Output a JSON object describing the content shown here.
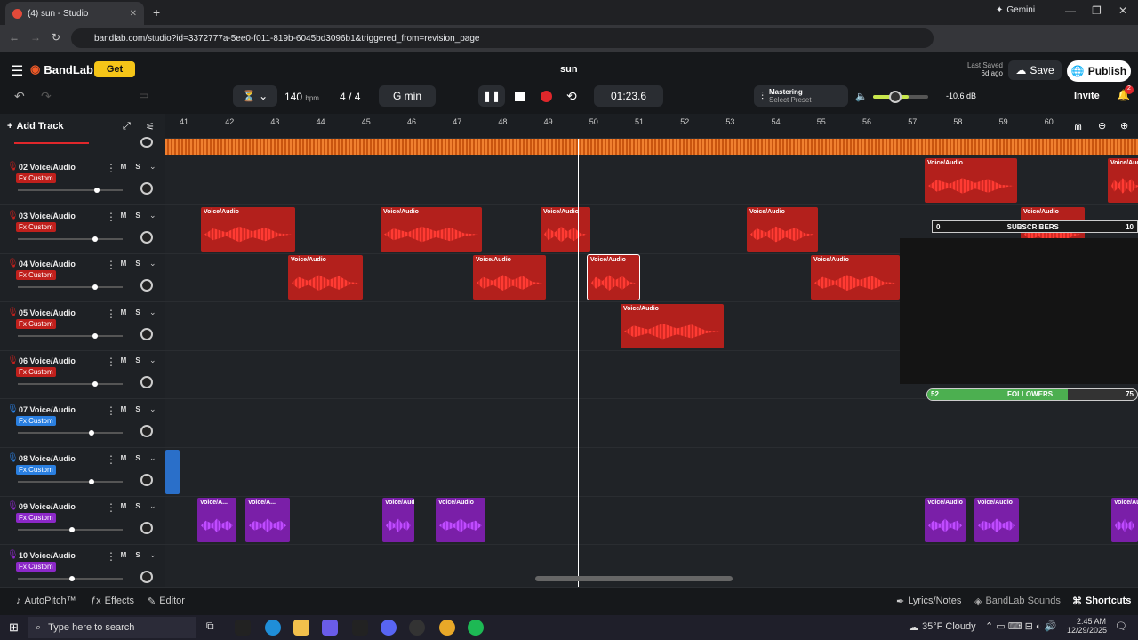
{
  "browser": {
    "tab_title": "(4) sun - Studio",
    "url": "bandlab.com/studio?id=3372777a-5ee0-f011-819b-6045bd3096b1&triggered_from=revision_page",
    "gemini_label": "Gemini"
  },
  "header": {
    "logo_text": "BandLab",
    "get_label": "Get",
    "project_title": "sun",
    "last_saved_label": "Last Saved",
    "last_saved_value": "6d ago",
    "save_label": "Save",
    "publish_label": "Publish",
    "invite_label": "Invite",
    "notif_count": "2"
  },
  "transport": {
    "bpm": "140",
    "bpm_unit": "bpm",
    "time_sig_num": "4",
    "time_sig_den": "4",
    "key": "G min",
    "time": "01:23.6",
    "mastering_label": "Mastering",
    "mastering_preset": "Select Preset",
    "volume_db": "-10.6 dB"
  },
  "toolbar": {
    "add_track_label": "Add Track"
  },
  "ruler": [
    "41",
    "42",
    "43",
    "44",
    "45",
    "46",
    "47",
    "48",
    "49",
    "50",
    "51",
    "52",
    "53",
    "54",
    "55",
    "56",
    "57",
    "58",
    "59",
    "60"
  ],
  "tracks": [
    {
      "name": "02 Voice/Audio",
      "fx": "Fx Custom",
      "color": "#c0201c"
    },
    {
      "name": "03 Voice/Audio",
      "fx": "Fx Custom",
      "color": "#c0201c"
    },
    {
      "name": "04 Voice/Audio",
      "fx": "Fx Custom",
      "color": "#c0201c"
    },
    {
      "name": "05 Voice/Audio",
      "fx": "Fx Custom",
      "color": "#c0201c"
    },
    {
      "name": "06 Voice/Audio",
      "fx": "Fx Custom",
      "color": "#c0201c"
    },
    {
      "name": "07 Voice/Audio",
      "fx": "Fx Custom",
      "color": "#2a7fe0"
    },
    {
      "name": "08 Voice/Audio",
      "fx": "Fx Custom",
      "color": "#2a7fe0"
    },
    {
      "name": "09 Voice/Audio",
      "fx": "Fx Custom",
      "color": "#8c28c8"
    },
    {
      "name": "10 Voice/Audio",
      "fx": "Fx Custom",
      "color": "#8c28c8"
    }
  ],
  "clip_label": "Voice/Audio",
  "clip_label_short": "Voice/A...",
  "overlay": {
    "subs_min": "0",
    "subs_label": "SUBSCRIBERS",
    "subs_max": "10",
    "followers_min": "52",
    "followers_label": "FOLLOWERS",
    "followers_max": "75"
  },
  "bottom": {
    "autopitch": "AutoPitch™",
    "effects": "Effects",
    "editor": "Editor",
    "lyrics": "Lyrics/Notes",
    "sounds": "BandLab Sounds",
    "shortcuts": "Shortcuts"
  },
  "taskbar": {
    "search_placeholder": "Type here to search",
    "weather": "35°F Cloudy",
    "time": "2:45 AM",
    "date": "12/29/2025"
  }
}
